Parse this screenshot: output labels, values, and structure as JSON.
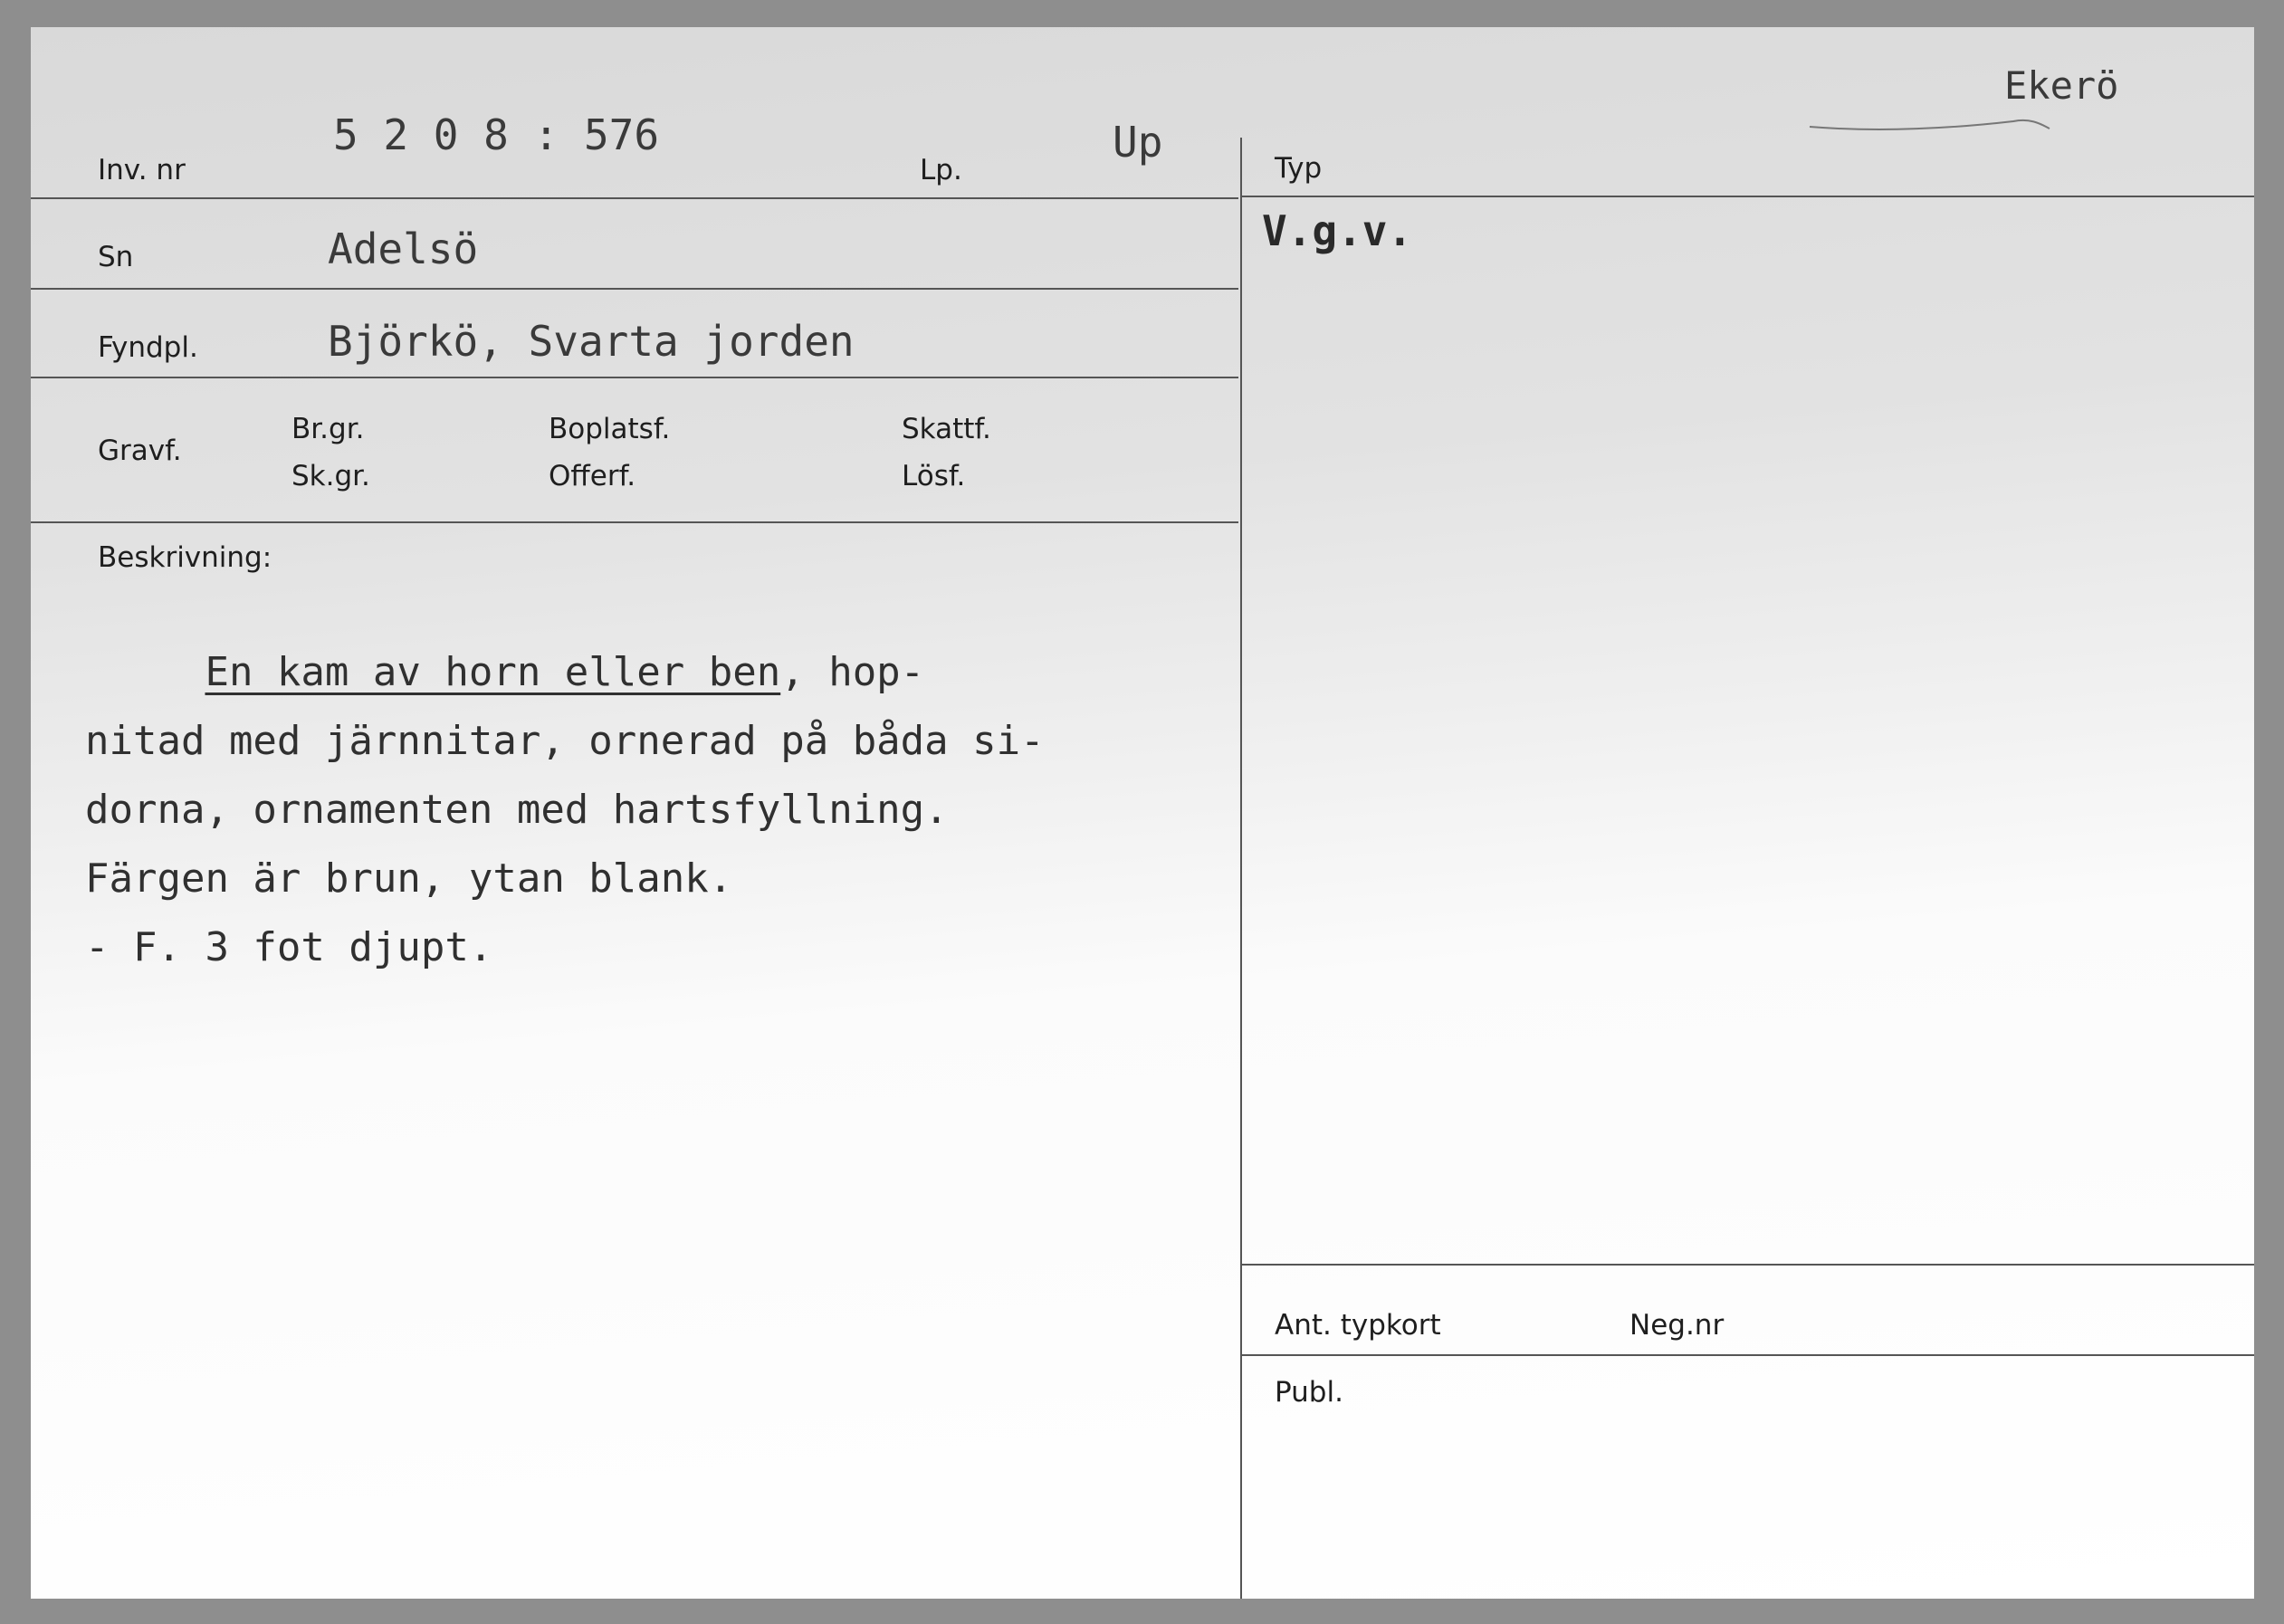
{
  "labels": {
    "inv_nr": "Inv. nr",
    "lp": "Lp.",
    "typ": "Typ",
    "sn": "Sn",
    "fyndpl": "Fyndpl.",
    "gravf": "Gravf.",
    "br_gr": "Br.gr.",
    "sk_gr": "Sk.gr.",
    "boplatsf": "Boplatsf.",
    "offerf": "Offerf.",
    "skattf": "Skattf.",
    "losf": "Lösf.",
    "beskrivning": "Beskrivning:",
    "ant_typkort": "Ant. typkort",
    "neg_nr": "Neg.nr",
    "publ": "Publ."
  },
  "values": {
    "inv_nr": "5 2 0 8 : 576",
    "province": "Up",
    "region": "Ekerö",
    "sn": "Adelsö",
    "fyndpl": "Björkö, Svarta jorden",
    "typ": "V.g.v."
  },
  "description": {
    "line1_indent": "     ",
    "line1_underlined": "En kam av horn eller ben",
    "line1_rest": ", hop-",
    "line2": "nitad med järnnitar, ornerad på båda si-",
    "line3": "dorna, ornamenten med hartsfyllning.",
    "line4": "Färgen är brun, ytan blank.",
    "line5": "- F. 3 fot djupt."
  }
}
